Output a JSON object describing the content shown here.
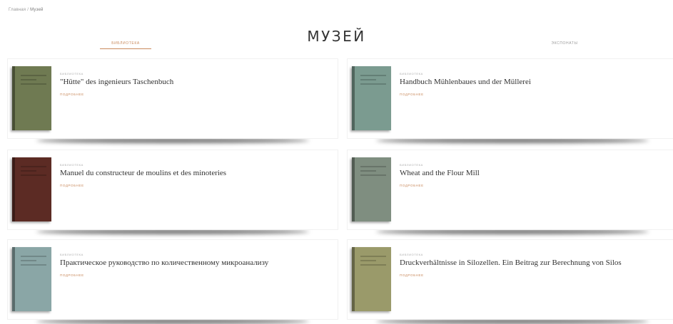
{
  "breadcrumb": {
    "home": "Главная",
    "separator": "/",
    "current": "Музей"
  },
  "page": {
    "title": "МУЗЕЙ"
  },
  "tabs": [
    {
      "label": "Библиотека",
      "active": true
    },
    {
      "label": "Экспонаты",
      "active": false
    }
  ],
  "colors": {
    "accent": "#c98a5d"
  },
  "books": [
    {
      "kicker": "Библиотека",
      "title": "\"Hütte\" des ingenieurs Taschenbuch",
      "subtitle": "",
      "description": "",
      "more": "Подробнее",
      "cover_color": "#6f7a52"
    },
    {
      "kicker": "Библиотека",
      "title": "Handbuch Mühlenbaues und der Müllerei",
      "subtitle": "",
      "description": "",
      "more": "Подробнее",
      "cover_color": "#7b9b90"
    },
    {
      "kicker": "Библиотека",
      "title": "Manuel du constructeur de moulins et des minoteries",
      "subtitle": "",
      "description": "",
      "more": "Подробнее",
      "cover_color": "#5c2b24"
    },
    {
      "kicker": "Библиотека",
      "title": "Wheat and the Flour Mill",
      "subtitle": "",
      "description": "",
      "more": "Подробнее",
      "cover_color": "#7f8e80"
    },
    {
      "kicker": "Библиотека",
      "title": "Практическое руководство по количественному микроанализу",
      "subtitle": "",
      "description": "",
      "more": "Подробнее",
      "cover_color": "#8aa6a6"
    },
    {
      "kicker": "Библиотека",
      "title": "Druckverhältnisse in Silozellen. Ein Beitrag zur Berechnung von Silos",
      "subtitle": "",
      "description": "",
      "more": "Подробнее",
      "cover_color": "#9a9a6a"
    }
  ]
}
